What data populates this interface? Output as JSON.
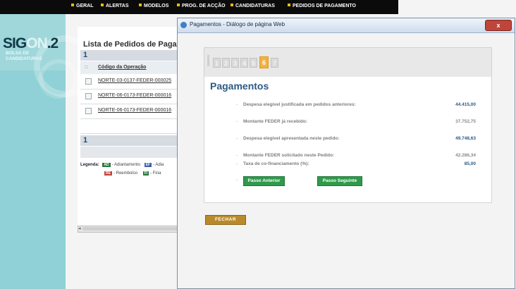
{
  "app": {
    "logo_main": "SIG",
    "logo_accent": "ON",
    "logo_suffix": ".2",
    "logo_sub_line1": "BOLSA DE",
    "logo_sub_line2": "CANDIDATURAS"
  },
  "nav": {
    "items": [
      "GERAL",
      "ALERTAS",
      "MODELOS",
      "PROG. DE ACÇÃO",
      "CANDIDATURAS",
      "PEDIDOS DE PAGAMENTO"
    ]
  },
  "list": {
    "title": "Lista de Pedidos de Pagame",
    "page": "1",
    "page_bottom": "1",
    "column_code": "Código da Operação",
    "select_icon": "::",
    "rows": [
      "NORTE-03-0137-FEDER-000025",
      "NORTE-06-0173-FEDER-000016",
      "NORTE-06-0173-FEDER-000016"
    ],
    "legend_label": "Legenda:",
    "legend": [
      {
        "badge": "AD",
        "text": "- Adiantamento",
        "color": "#2a7a3b"
      },
      {
        "badge": "EF",
        "text": "- Adia",
        "color": "#3b5fa8"
      },
      {
        "badge": "RE",
        "text": "- Reembolso",
        "color": "#c0443a"
      },
      {
        "badge": "FI",
        "text": "- Fina",
        "color": "#2a7a3b"
      }
    ]
  },
  "dialog": {
    "title": "Pagamentos - Diálogo de página Web",
    "close_label": "x",
    "steps_label": "passos",
    "steps": [
      "1",
      "2",
      "3",
      "4",
      "5",
      "6",
      "7"
    ],
    "active_step": "6",
    "section_title": "Pagamentos",
    "fields": [
      {
        "label": "Despesa elegível justificada em pedidos anteriores:",
        "value": "44.415,00",
        "style": "blue"
      },
      {
        "label": "Montante FEDER já recebido:",
        "value": "37.752,75",
        "style": "grey"
      },
      {
        "label": "Despesa elegível apresentada neste pedido:",
        "value": "49.748,63",
        "style": "blue"
      },
      {
        "label": "Montante FEDER solicitado neste Pedido:",
        "value": "42.286,34",
        "style": "grey"
      },
      {
        "label": "Taxa de co-financiamento (%):",
        "value": "85,00",
        "style": "blue"
      }
    ],
    "bullet": "-",
    "btn_prev": "Passo Anterior",
    "btn_next": "Passo Seguinte",
    "btn_close": "FECHAR"
  },
  "colors": {
    "sidebar": "#8fd1d6",
    "nav": "#0b0b0b",
    "accent_blue": "#2c5a84",
    "green_button": "#2f9a4a",
    "step_active": "#f2b240",
    "close_button": "#b88a2a"
  }
}
